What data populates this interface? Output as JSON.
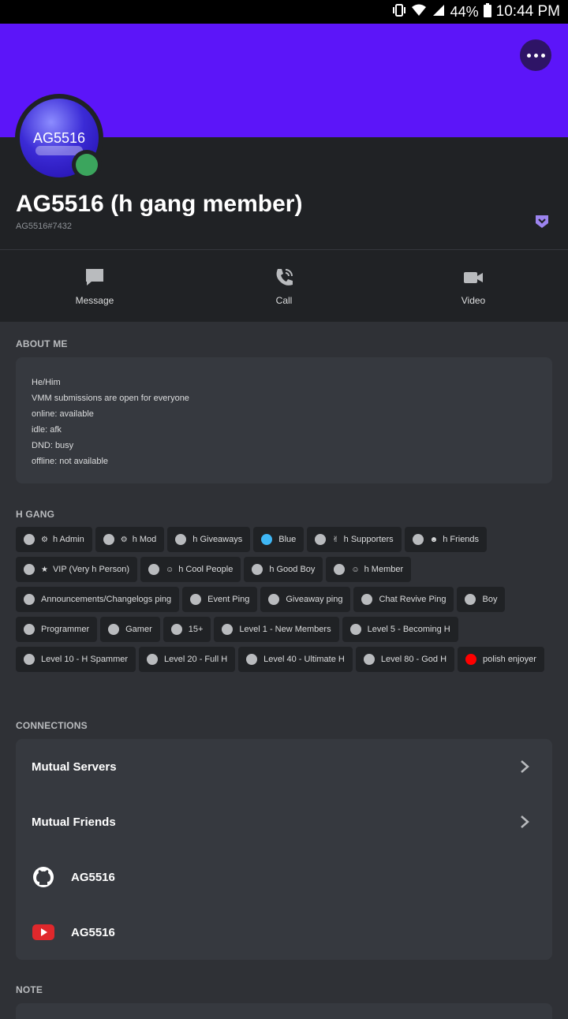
{
  "status_bar": {
    "battery": "44%",
    "time": "10:44 PM"
  },
  "profile": {
    "avatar_text": "AG5516",
    "display_name": "AG5516 (h gang member)",
    "tag": "AG5516#7432",
    "status_color": "#3ba55d",
    "banner_color": "#5c15f9"
  },
  "actions": [
    {
      "label": "Message",
      "icon": "message-icon"
    },
    {
      "label": "Call",
      "icon": "call-icon"
    },
    {
      "label": "Video",
      "icon": "video-icon"
    }
  ],
  "about": {
    "title": "ABOUT ME",
    "lines": [
      "He/Him",
      "VMM submissions are open for everyone",
      "online: available",
      "idle: afk",
      "DND: busy",
      "offline: not available"
    ]
  },
  "roles_section": {
    "title": "H GANG",
    "roles": [
      {
        "label": "h Admin",
        "color": "#b9bbbe",
        "emoji": "⚙"
      },
      {
        "label": "h Mod",
        "color": "#b9bbbe",
        "emoji": "⚙"
      },
      {
        "label": "h Giveaways",
        "color": "#b9bbbe",
        "emoji": ""
      },
      {
        "label": "Blue",
        "color": "#3fb7f5",
        "emoji": ""
      },
      {
        "label": "h Supporters",
        "color": "#b9bbbe",
        "emoji": "✌"
      },
      {
        "label": "h Friends",
        "color": "#b9bbbe",
        "emoji": "☻"
      },
      {
        "label": "VIP (Very h Person)",
        "color": "#b9bbbe",
        "emoji": "★"
      },
      {
        "label": "h Cool People",
        "color": "#b9bbbe",
        "emoji": "☺"
      },
      {
        "label": "h Good Boy",
        "color": "#b9bbbe",
        "emoji": ""
      },
      {
        "label": "h Member",
        "color": "#b9bbbe",
        "emoji": "☺"
      },
      {
        "label": "Announcements/Changelogs ping",
        "color": "#b9bbbe",
        "emoji": ""
      },
      {
        "label": "Event Ping",
        "color": "#b9bbbe",
        "emoji": ""
      },
      {
        "label": "Giveaway ping",
        "color": "#b9bbbe",
        "emoji": ""
      },
      {
        "label": "Chat Revive Ping",
        "color": "#b9bbbe",
        "emoji": ""
      },
      {
        "label": "Boy",
        "color": "#b9bbbe",
        "emoji": ""
      },
      {
        "label": "Programmer",
        "color": "#b9bbbe",
        "emoji": ""
      },
      {
        "label": "Gamer",
        "color": "#b9bbbe",
        "emoji": ""
      },
      {
        "label": "15+",
        "color": "#b9bbbe",
        "emoji": ""
      },
      {
        "label": "Level 1 - New Members",
        "color": "#b9bbbe",
        "emoji": ""
      },
      {
        "label": "Level 5 - Becoming H",
        "color": "#b9bbbe",
        "emoji": ""
      },
      {
        "label": "Level 10 - H Spammer",
        "color": "#b9bbbe",
        "emoji": ""
      },
      {
        "label": "Level 20 - Full H",
        "color": "#b9bbbe",
        "emoji": ""
      },
      {
        "label": "Level 40 - Ultimate H",
        "color": "#b9bbbe",
        "emoji": ""
      },
      {
        "label": "Level 80 - God H",
        "color": "#b9bbbe",
        "emoji": ""
      },
      {
        "label": "polish enjoyer",
        "color": "#ff0000",
        "emoji": ""
      }
    ]
  },
  "connections": {
    "title": "CONNECTIONS",
    "mutual_servers": "Mutual Servers",
    "mutual_friends": "Mutual Friends",
    "accounts": [
      {
        "service": "github-icon",
        "name": "AG5516"
      },
      {
        "service": "youtube-icon",
        "name": "AG5516"
      }
    ]
  },
  "note": {
    "title": "NOTE"
  }
}
